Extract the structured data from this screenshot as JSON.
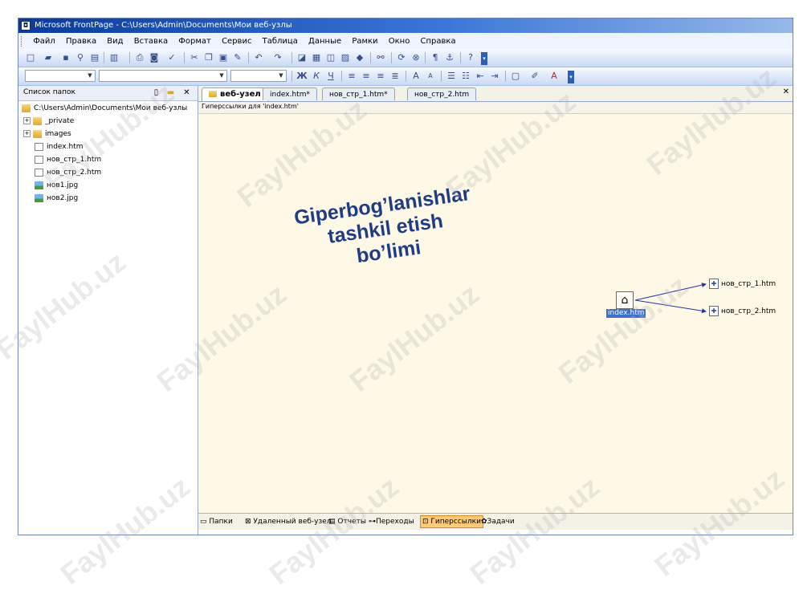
{
  "window": {
    "title": "Microsoft FrontPage - C:\\Users\\Admin\\Documents\\Мои веб-узлы"
  },
  "menu": [
    "Файл",
    "Правка",
    "Вид",
    "Вставка",
    "Формат",
    "Сервис",
    "Таблица",
    "Данные",
    "Рамки",
    "Окно",
    "Справка"
  ],
  "toolbar2": {
    "bold": "Ж",
    "italic": "К",
    "underline": "Ч"
  },
  "folder_pane": {
    "title": "Список папок",
    "root": "C:\\Users\\Admin\\Documents\\Мои веб-узлы",
    "items": [
      {
        "label": "_private",
        "type": "folder",
        "expander": "+"
      },
      {
        "label": "images",
        "type": "folder",
        "expander": "+"
      },
      {
        "label": "index.htm",
        "type": "home-page"
      },
      {
        "label": "нов_стр_1.htm",
        "type": "page"
      },
      {
        "label": "нов_стр_2.htm",
        "type": "page"
      },
      {
        "label": "нов1.jpg",
        "type": "image"
      },
      {
        "label": "нов2.jpg",
        "type": "image"
      }
    ]
  },
  "tabs": [
    "веб-узел",
    "index.htm*",
    "нов_стр_1.htm*",
    "нов_стр_2.htm"
  ],
  "subheader": "Гиперссылки для 'index.htm'",
  "overlay_text": [
    "Giperbog’lanishlar",
    "tashkil etish",
    "bo’limi"
  ],
  "hyperlinks": {
    "root": "index.htm",
    "children": [
      "нов_стр_1.htm",
      "нов_стр_2.htm"
    ]
  },
  "view_buttons": [
    "Папки",
    "Удаленный веб-узел",
    "Отчеты",
    "Переходы",
    "Гиперссылки",
    "Задачи"
  ],
  "active_view": "Гиперссылки",
  "watermark": "FaylHub.uz"
}
